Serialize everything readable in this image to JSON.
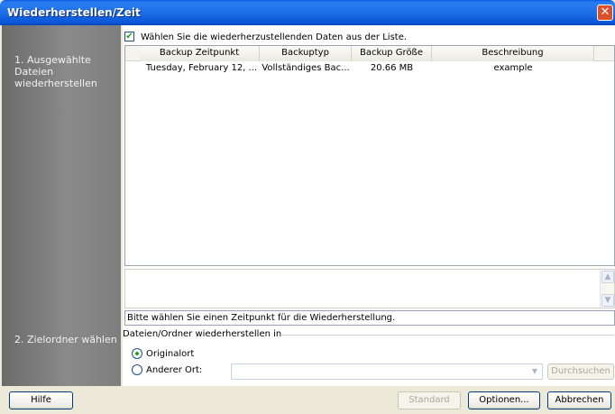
{
  "window": {
    "title": "Wiederherstellen/Zeit",
    "close_glyph": "✕"
  },
  "sidebar": {
    "steps": [
      {
        "label": "1. Ausgewählte Dateien wiederherstellen"
      },
      {
        "label": "2. Zielordner wählen"
      }
    ]
  },
  "main": {
    "select_all_checked": true,
    "check_glyph": "✔",
    "select_all_label": "Wählen Sie die wiederherzustellenden Daten aus der Liste.",
    "columns": [
      "Backup Zeitpunkt",
      "Backuptyp",
      "Backup Größe",
      "Beschreibung"
    ],
    "rows": [
      {
        "zeitpunkt": "Tuesday, February 12, ...",
        "typ": "Vollständiges Bac...",
        "groesse": "20.66 MB",
        "beschreibung": "example"
      }
    ],
    "hint": "Bitte wählen Sie einen Zeitpunkt für die Wiederherstellung.",
    "restore_group_label": "Dateien/Ordner wiederherstellen in",
    "options": [
      {
        "label": "Originalort",
        "selected": true
      },
      {
        "label": "Anderer Ort:",
        "selected": false
      }
    ],
    "other_path_value": "",
    "browse_label": "Durchsuchen",
    "scroll_up_glyph": "▲",
    "scroll_down_glyph": "▼",
    "dropdown_glyph": "▼"
  },
  "footer": {
    "help_label": "Hilfe",
    "standard_label": "Standard",
    "options_label": "Optionen...",
    "cancel_label": "Abbrechen"
  }
}
